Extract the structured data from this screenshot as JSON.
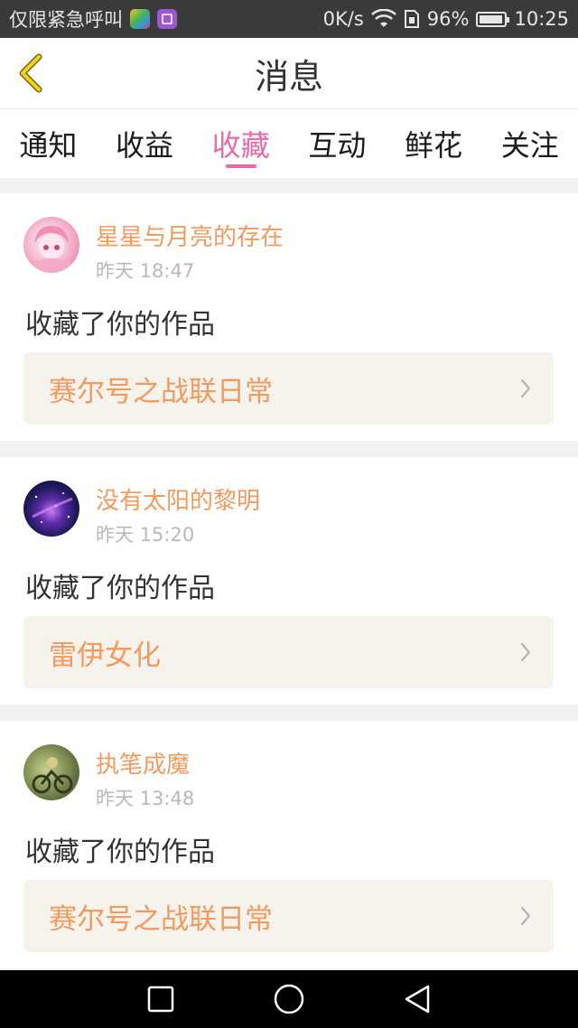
{
  "status_bar": {
    "carrier": "仅限紧急呼叫",
    "speed": "0K/s",
    "battery_percent": "96%",
    "time": "10:25",
    "icons": [
      "app-colorful-icon",
      "gallery-app-icon",
      "wifi-icon",
      "sim-icon",
      "battery-icon"
    ]
  },
  "header": {
    "title": "消息",
    "back_icon": "chevron-left-icon"
  },
  "tabs": [
    {
      "label": "通知"
    },
    {
      "label": "收益"
    },
    {
      "label": "收藏",
      "active": true
    },
    {
      "label": "互动"
    },
    {
      "label": "鲜花"
    },
    {
      "label": "关注"
    }
  ],
  "messages": [
    {
      "user": "星星与月亮的存在",
      "time": "昨天 18:47",
      "action": "收藏了你的作品",
      "work": "赛尔号之战联日常"
    },
    {
      "user": "没有太阳的黎明",
      "time": "昨天 15:20",
      "action": "收藏了你的作品",
      "work": "雷伊女化"
    },
    {
      "user": "执笔成魔",
      "time": "昨天 13:48",
      "action": "收藏了你的作品",
      "work": "赛尔号之战联日常"
    }
  ],
  "colors": {
    "accent": "#e86aa6",
    "orange": "#f39a5e",
    "link_bg": "#f5f3ec"
  },
  "nav": {
    "icons": [
      "recent-apps-icon",
      "home-icon",
      "back-triangle-icon"
    ]
  }
}
